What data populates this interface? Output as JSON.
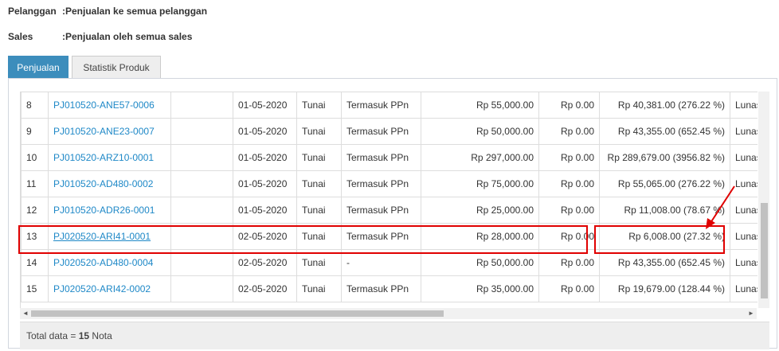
{
  "filters": {
    "pelanggan_label": "Pelanggan",
    "pelanggan_value": ":Penjualan ke semua pelanggan",
    "sales_label": "Sales",
    "sales_value": ":Penjualan oleh semua sales"
  },
  "tabs": [
    {
      "label": "Penjualan",
      "active": true
    },
    {
      "label": "Statistik Produk",
      "active": false
    }
  ],
  "rows": [
    {
      "no": "8",
      "code": "PJ010520-ANE57-0006",
      "date": "01-05-2020",
      "method": "Tunai",
      "tax": "Termasuk PPn",
      "total": "Rp 55,000.00",
      "disc": "Rp 0.00",
      "profit": "Rp 40,381.00 (276.22 %)",
      "status": "Lunas"
    },
    {
      "no": "9",
      "code": "PJ010520-ANE23-0007",
      "date": "01-05-2020",
      "method": "Tunai",
      "tax": "Termasuk PPn",
      "total": "Rp 50,000.00",
      "disc": "Rp 0.00",
      "profit": "Rp 43,355.00 (652.45 %)",
      "status": "Lunas"
    },
    {
      "no": "10",
      "code": "PJ010520-ARZ10-0001",
      "date": "01-05-2020",
      "method": "Tunai",
      "tax": "Termasuk PPn",
      "total": "Rp 297,000.00",
      "disc": "Rp 0.00",
      "profit": "Rp 289,679.00 (3956.82 %)",
      "status": "Lunas"
    },
    {
      "no": "11",
      "code": "PJ010520-AD480-0002",
      "date": "01-05-2020",
      "method": "Tunai",
      "tax": "Termasuk PPn",
      "total": "Rp 75,000.00",
      "disc": "Rp 0.00",
      "profit": "Rp 55,065.00 (276.22 %)",
      "status": "Lunas"
    },
    {
      "no": "12",
      "code": "PJ010520-ADR26-0001",
      "date": "01-05-2020",
      "method": "Tunai",
      "tax": "Termasuk PPn",
      "total": "Rp 25,000.00",
      "disc": "Rp 0.00",
      "profit": "Rp 11,008.00 (78.67 %)",
      "status": "Lunas"
    },
    {
      "no": "13",
      "code": "PJ020520-ARI41-0001",
      "date": "02-05-2020",
      "method": "Tunai",
      "tax": "Termasuk PPn",
      "total": "Rp 28,000.00",
      "disc": "Rp 0.00",
      "profit": "Rp 6,008.00 (27.32 %)",
      "status": "Lunas"
    },
    {
      "no": "14",
      "code": "PJ020520-AD480-0004",
      "date": "02-05-2020",
      "method": "Tunai",
      "tax": "-",
      "total": "Rp 50,000.00",
      "disc": "Rp 0.00",
      "profit": "Rp 43,355.00 (652.45 %)",
      "status": "Lunas"
    },
    {
      "no": "15",
      "code": "PJ020520-ARI42-0002",
      "date": "02-05-2020",
      "method": "Tunai",
      "tax": "Termasuk PPn",
      "total": "Rp 35,000.00",
      "disc": "Rp 0.00",
      "profit": "Rp 19,679.00 (128.44 %)",
      "status": "Lunas"
    }
  ],
  "footer": {
    "label": "Total data = ",
    "count": "15",
    "unit": " Nota"
  },
  "scroll_left_icon": "◄",
  "scroll_right_icon": "►"
}
